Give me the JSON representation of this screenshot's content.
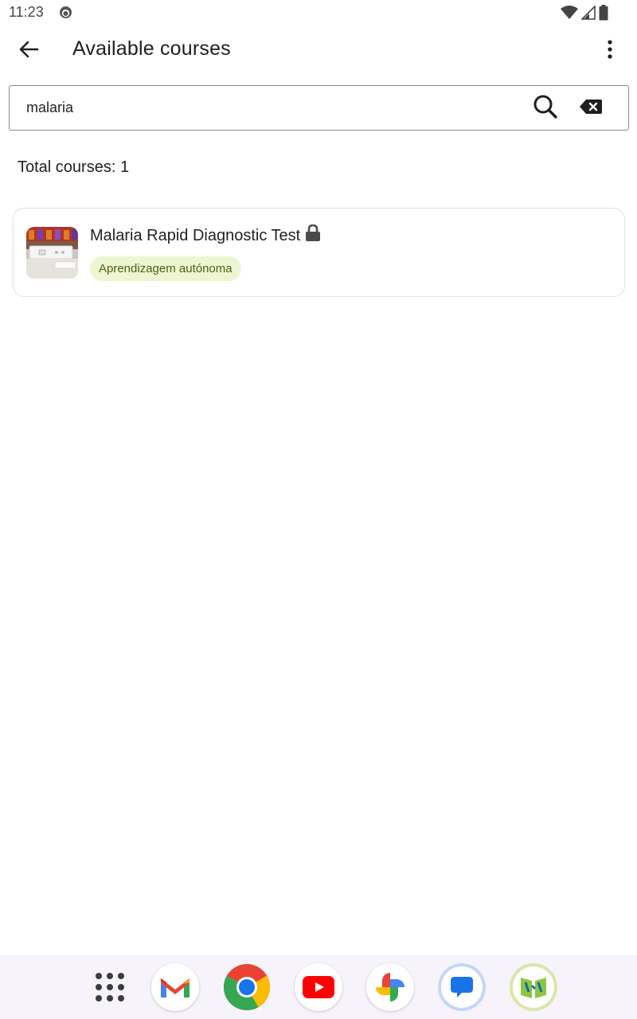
{
  "status_bar": {
    "time": "11:23",
    "icons": [
      "notification-face-icon",
      "wifi-icon",
      "signal-icon",
      "battery-icon"
    ]
  },
  "app_bar": {
    "title": "Available courses",
    "back_icon": "arrow-back-icon",
    "menu_icon": "more-vert-icon"
  },
  "search": {
    "value": "malaria",
    "search_icon": "search-icon",
    "clear_icon": "backspace-icon"
  },
  "results": {
    "total_label": "Total courses: 1"
  },
  "courses": [
    {
      "title": "Malaria Rapid Diagnostic Test",
      "locked": true,
      "badge": "Aprendizagem autónoma"
    }
  ],
  "dock": {
    "apps": [
      "app-drawer-icon",
      "gmail-icon",
      "chrome-icon",
      "youtube-icon",
      "photos-icon",
      "messages-icon",
      "reader-app-icon"
    ]
  },
  "colors": {
    "badge_bg": "#eef5d1",
    "badge_text": "#4b6310",
    "dock_bg": "#f6f3fa"
  }
}
